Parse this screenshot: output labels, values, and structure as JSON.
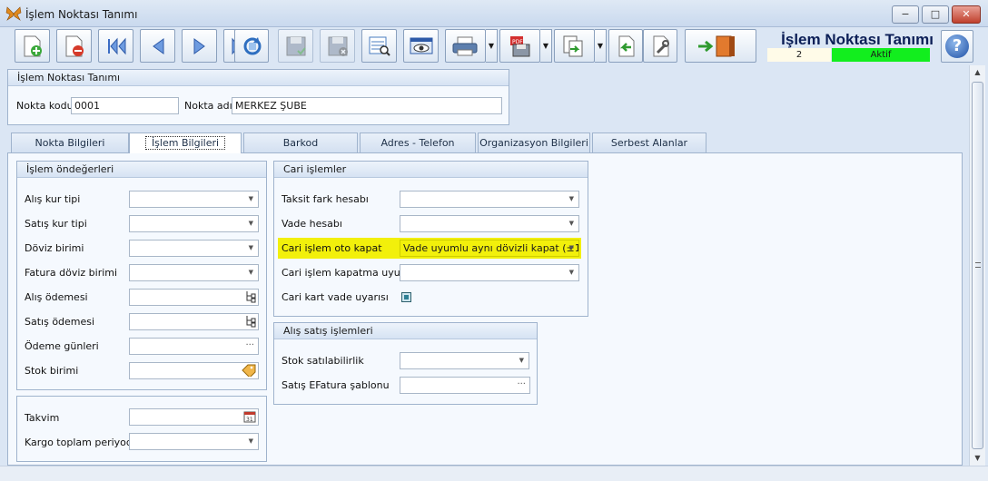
{
  "window": {
    "title": "İşlem Noktası Tanımı",
    "minimize": "−",
    "maximize": "□",
    "close": "✕"
  },
  "header": {
    "title": "İşlem Noktası Tanımı",
    "number": "2",
    "status": "Aktif",
    "status_color": "#12ee1e"
  },
  "toolbar": {
    "buttons": [
      "new-record",
      "delete-record",
      "first-record",
      "previous-record",
      "next-record",
      "last-record",
      "refresh",
      "save",
      "discard",
      "list-view",
      "preview",
      "print",
      "export-pdf",
      "import",
      "back",
      "tools",
      "exit"
    ]
  },
  "point_group": {
    "caption": "İşlem Noktası Tanımı",
    "code_label": "Nokta kodu",
    "code_value": "0001",
    "name_label": "Nokta adı",
    "name_value": "MERKEZ ŞUBE"
  },
  "tabs": [
    "Nokta Bilgileri",
    "İşlem Bilgileri",
    "Barkod",
    "Adres - Telefon",
    "Organizasyon Bilgileri",
    "Serbest Alanlar"
  ],
  "active_tab": "İşlem Bilgileri",
  "defaults_group": {
    "caption": "İşlem öndeğerleri",
    "fields": [
      "Alış kur tipi",
      "Satış kur tipi",
      "Döviz birimi",
      "Fatura döviz birimi",
      "Alış ödemesi",
      "Satış ödemesi",
      "Ödeme günleri",
      "Stok birimi"
    ]
  },
  "calendar_group": {
    "fields": [
      "Takvim",
      "Kargo toplam periyodu"
    ]
  },
  "account_group": {
    "caption": "Cari işlemler",
    "fields": [
      "Taksit fark hesabı",
      "Vade hesabı",
      "Cari işlem oto kapat",
      "Cari işlem kapatma uyumu",
      "Cari kart vade uyarısı"
    ],
    "auto_close_value": "Vade uyumlu aynı dövizli kapat (±1)",
    "highlight_color": "#f2f00b"
  },
  "sales_group": {
    "caption": "Alış satış işlemleri",
    "fields": [
      "Stok satılabilirlik",
      "Satış EFatura şablonu"
    ]
  },
  "glyphs": {
    "dropdown": "▼",
    "ellipsis": "···",
    "scroll_up": "▲",
    "scroll_down": "▼"
  }
}
